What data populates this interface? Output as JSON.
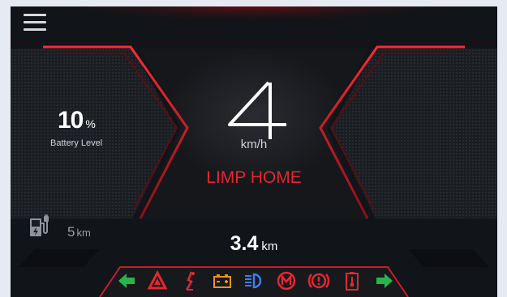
{
  "colors": {
    "background": "#111418",
    "accent_red": "#e02830",
    "indicator_green": "#27b44a",
    "indicator_orange": "#f0901e",
    "indicator_blue": "#3a7ff0",
    "text_primary": "#ffffff"
  },
  "header": {
    "menu_icon": "hamburger-menu-icon"
  },
  "speed": {
    "value": "4",
    "unit": "km/h"
  },
  "battery": {
    "value": "10",
    "unit": "%",
    "label": "Battery Level"
  },
  "range": {
    "value": "5",
    "unit": "km",
    "icon": "charging-station-icon"
  },
  "mode": {
    "label": "LIMP HOME"
  },
  "trip": {
    "value": "3.4",
    "unit": "km"
  },
  "indicators": [
    {
      "name": "left-turn-indicator-icon",
      "color": "#27b44a"
    },
    {
      "name": "hazard-warning-icon",
      "color": "#e02830"
    },
    {
      "name": "side-stand-icon",
      "color": "#e02830"
    },
    {
      "name": "battery-warning-icon",
      "color": "#f0901e"
    },
    {
      "name": "headlight-icon",
      "color": "#3a7ff0"
    },
    {
      "name": "motor-warning-icon",
      "color": "#e02830"
    },
    {
      "name": "brake-warning-icon",
      "color": "#e02830"
    },
    {
      "name": "battery-temperature-icon",
      "color": "#e02830"
    },
    {
      "name": "right-turn-indicator-icon",
      "color": "#27b44a"
    }
  ]
}
